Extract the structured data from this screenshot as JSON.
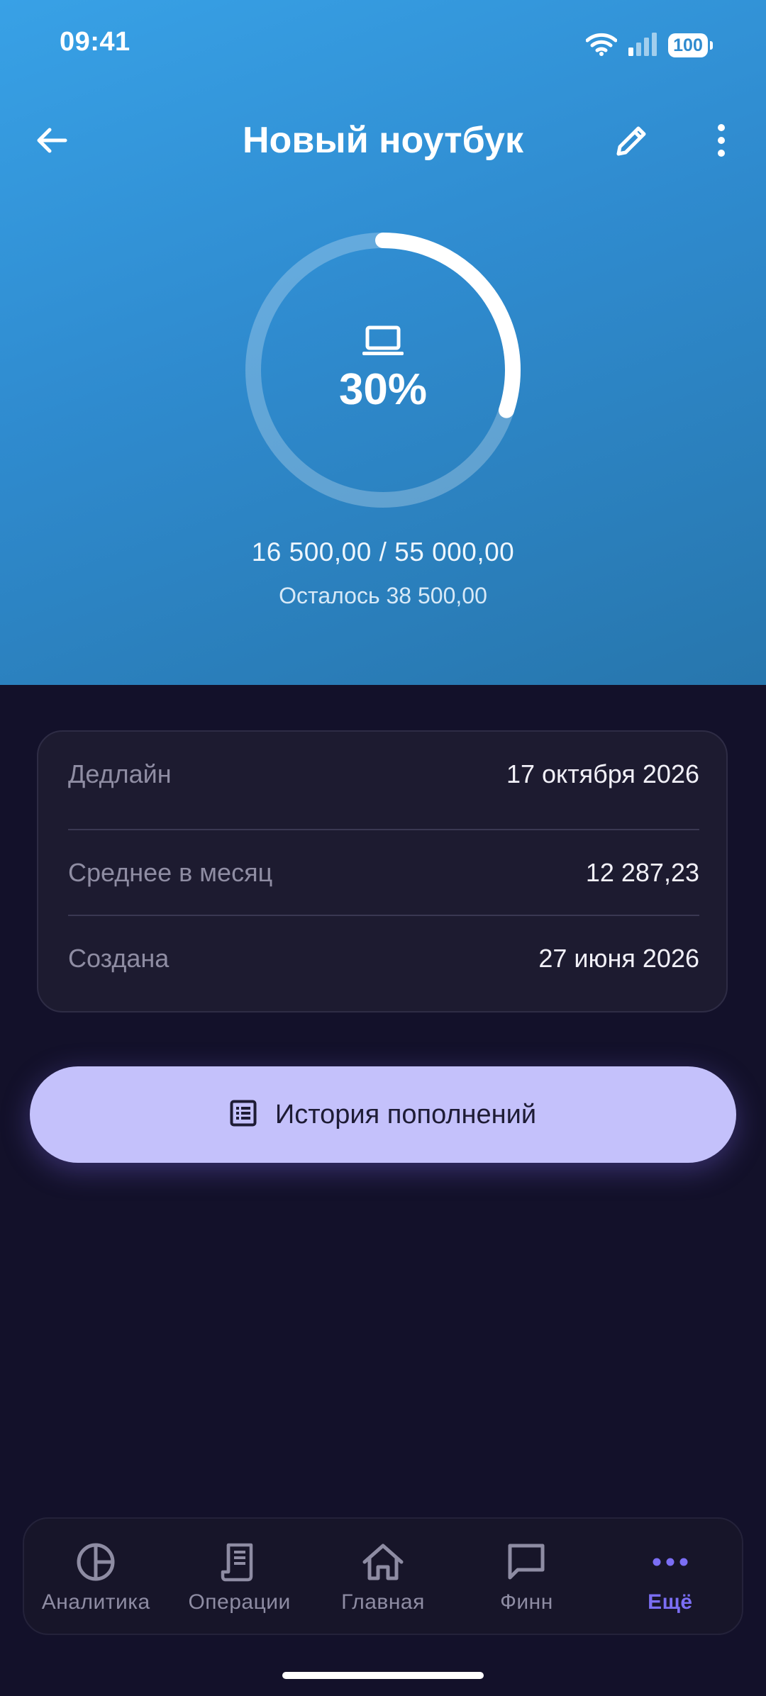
{
  "status_bar": {
    "time": "09:41",
    "battery": "100"
  },
  "header": {
    "title": "Новый ноутбук",
    "goal_icon": "laptop-icon"
  },
  "progress": {
    "fraction": 0.3,
    "percent_label": "30%",
    "amounts": "16 500,00 / 55 000,00",
    "remaining": "Осталось 38 500,00"
  },
  "details": [
    {
      "label": "Дедлайн",
      "value": "17 октября 2026"
    },
    {
      "label": "Среднее в месяц",
      "value": "12 287,23"
    },
    {
      "label": "Создана",
      "value": "27 июня 2026"
    }
  ],
  "history_button": {
    "label": "История пополнений"
  },
  "bottom_nav": {
    "items": [
      {
        "label": "Аналитика",
        "icon": "pie-chart-icon"
      },
      {
        "label": "Операции",
        "icon": "receipt-icon"
      },
      {
        "label": "Главная",
        "icon": "home-icon"
      },
      {
        "label": "Финн",
        "icon": "chat-icon"
      },
      {
        "label": "Ещё",
        "icon": "more-dots-icon",
        "active": true
      }
    ]
  },
  "colors": {
    "accent": "#7b6ef4",
    "hero_start": "#38a1e6",
    "hero_end": "#2776ad",
    "button_bg": "#c4c1fb",
    "background": "#13112a"
  }
}
